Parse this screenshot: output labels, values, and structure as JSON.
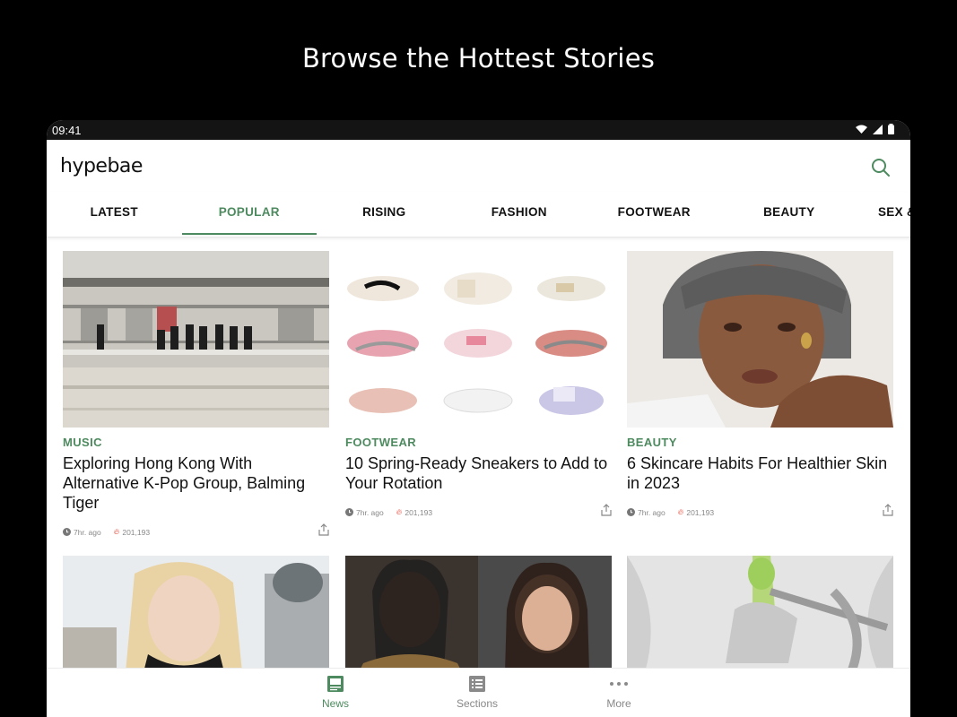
{
  "promo": {
    "title": "Browse the Hottest Stories"
  },
  "status_bar": {
    "time": "09:41"
  },
  "app": {
    "logo": "hypebae"
  },
  "tabs": [
    {
      "label": "LATEST"
    },
    {
      "label": "POPULAR"
    },
    {
      "label": "RISING"
    },
    {
      "label": "FASHION"
    },
    {
      "label": "FOOTWEAR"
    },
    {
      "label": "BEAUTY"
    },
    {
      "label": "SEX &"
    }
  ],
  "articles": [
    {
      "category": "MUSIC",
      "title": "Exploring Hong Kong With Alternative K-Pop Group, Balming Tiger",
      "time": "7hr. ago",
      "views": "201,193"
    },
    {
      "category": "FOOTWEAR",
      "title": "10 Spring-Ready Sneakers to Add to Your Rotation",
      "time": "7hr. ago",
      "views": "201,193"
    },
    {
      "category": "BEAUTY",
      "title": "6 Skincare Habits For Healthier Skin in 2023",
      "time": "7hr. ago",
      "views": "201,193"
    }
  ],
  "bottom_nav": [
    {
      "label": "News"
    },
    {
      "label": "Sections"
    },
    {
      "label": "More"
    }
  ],
  "colors": {
    "accent": "#4e8a5f",
    "fire": "#e03c2b"
  }
}
